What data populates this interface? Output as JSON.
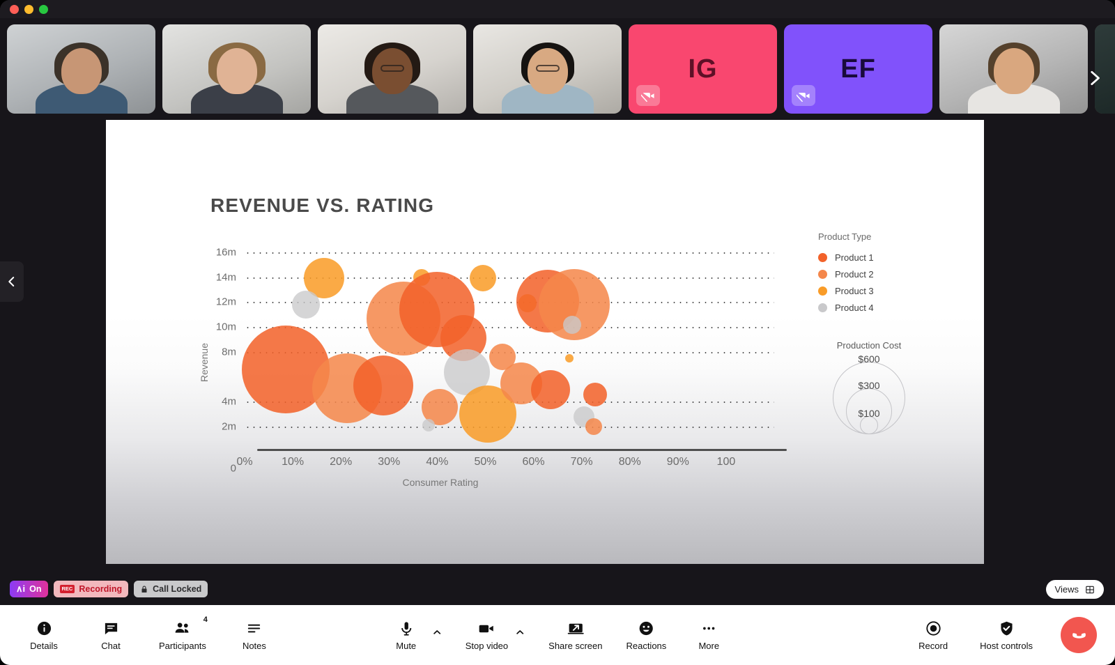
{
  "window": {
    "traffic_lights": [
      "close",
      "minimize",
      "zoom"
    ]
  },
  "filmstrip": {
    "next_icon": "chevron-right-icon",
    "participants": [
      {
        "type": "video",
        "name": "participant-1",
        "camera_off": false
      },
      {
        "type": "video",
        "name": "participant-2",
        "camera_off": false
      },
      {
        "type": "video",
        "name": "participant-3",
        "camera_off": false
      },
      {
        "type": "video",
        "name": "participant-4",
        "camera_off": false
      },
      {
        "type": "initials",
        "name": "participant-ig",
        "initials": "IG",
        "bg": "#f9476f",
        "fg": "#5e1027",
        "camera_off": true
      },
      {
        "type": "initials",
        "name": "participant-ef",
        "initials": "EF",
        "bg": "#8152fb",
        "fg": "#190a3c",
        "camera_off": true
      },
      {
        "type": "video",
        "name": "participant-7",
        "camera_off": false
      },
      {
        "type": "video",
        "name": "participant-8",
        "camera_off": false
      }
    ]
  },
  "stage": {
    "prev_icon": "chevron-left-icon"
  },
  "chart_data": {
    "type": "scatter",
    "title": "REVENUE VS. RATING",
    "xlabel": "Consumer Rating",
    "ylabel": "Revenue",
    "xlim": [
      0,
      110
    ],
    "ylim": [
      0,
      17
    ],
    "grid": true,
    "xticklabels": [
      "0%",
      "10%",
      "20%",
      "30%",
      "40%",
      "50%",
      "60%",
      "70%",
      "80%",
      "90%",
      "100"
    ],
    "xtickvalues": [
      0,
      10,
      20,
      30,
      40,
      50,
      60,
      70,
      80,
      90,
      100
    ],
    "yticklabels": [
      "16m",
      "14m",
      "12m",
      "10m",
      "8m",
      "4m",
      "2m",
      "0"
    ],
    "ytickvalues": [
      16,
      14,
      12,
      10,
      8,
      4,
      2,
      0
    ],
    "legend_title": "Product Type",
    "legend": [
      {
        "label": "Product 1",
        "color": "#f2622a"
      },
      {
        "label": "Product 2",
        "color": "#f4874b"
      },
      {
        "label": "Product 3",
        "color": "#f99c28"
      },
      {
        "label": "Product 4",
        "color": "#c9c9cb"
      }
    ],
    "size_legend_title": "Production Cost",
    "size_legend": [
      {
        "label": "$600",
        "radius": 52
      },
      {
        "label": "$300",
        "radius": 33
      },
      {
        "label": "$100",
        "radius": 13
      }
    ],
    "points": [
      {
        "x": 16.5,
        "y": 13.9,
        "r": 29,
        "series": "Product 3"
      },
      {
        "x": 12.8,
        "y": 11.8,
        "r": 20,
        "series": "Product 4"
      },
      {
        "x": 8.6,
        "y": 6.6,
        "r": 63,
        "series": "Product 1"
      },
      {
        "x": 21.3,
        "y": 5.1,
        "r": 50,
        "series": "Product 2"
      },
      {
        "x": 28.8,
        "y": 5.3,
        "r": 43,
        "series": "Product 1"
      },
      {
        "x": 33.0,
        "y": 10.7,
        "r": 53,
        "series": "Product 2"
      },
      {
        "x": 36.7,
        "y": 14.0,
        "r": 12,
        "series": "Product 3"
      },
      {
        "x": 40.0,
        "y": 11.4,
        "r": 54,
        "series": "Product 1"
      },
      {
        "x": 40.5,
        "y": 3.6,
        "r": 26,
        "series": "Product 2"
      },
      {
        "x": 38.2,
        "y": 2.1,
        "r": 9,
        "series": "Product 4"
      },
      {
        "x": 45.5,
        "y": 9.1,
        "r": 33,
        "series": "Product 1"
      },
      {
        "x": 46.2,
        "y": 6.4,
        "r": 33,
        "series": "Product 4"
      },
      {
        "x": 49.5,
        "y": 13.9,
        "r": 19,
        "series": "Product 3"
      },
      {
        "x": 50.5,
        "y": 3.0,
        "r": 41,
        "series": "Product 3"
      },
      {
        "x": 53.5,
        "y": 7.6,
        "r": 19,
        "series": "Product 2"
      },
      {
        "x": 57.5,
        "y": 5.5,
        "r": 30,
        "series": "Product 2"
      },
      {
        "x": 58.8,
        "y": 11.9,
        "r": 13,
        "series": "Product 3"
      },
      {
        "x": 63.0,
        "y": 12.1,
        "r": 45,
        "series": "Product 1"
      },
      {
        "x": 63.5,
        "y": 5.0,
        "r": 28,
        "series": "Product 1"
      },
      {
        "x": 67.5,
        "y": 7.5,
        "r": 6,
        "series": "Product 3"
      },
      {
        "x": 68.5,
        "y": 11.8,
        "r": 51,
        "series": "Product 2"
      },
      {
        "x": 68.0,
        "y": 10.2,
        "r": 13,
        "series": "Product 4"
      },
      {
        "x": 70.5,
        "y": 2.8,
        "r": 15,
        "series": "Product 4"
      },
      {
        "x": 72.8,
        "y": 4.6,
        "r": 17,
        "series": "Product 1"
      },
      {
        "x": 72.5,
        "y": 2.0,
        "r": 12,
        "series": "Product 2"
      }
    ]
  },
  "status_pills": {
    "ai": {
      "mark": "∧i",
      "label": "On"
    },
    "recording": {
      "badge": "REC",
      "label": "Recording"
    },
    "lock": {
      "icon": "lock-icon",
      "label": "Call Locked"
    }
  },
  "views_button": {
    "label": "Views",
    "icon": "grid-icon"
  },
  "controls": {
    "left": [
      {
        "name": "details",
        "label": "Details",
        "icon": "info-icon"
      },
      {
        "name": "chat",
        "label": "Chat",
        "icon": "chat-icon"
      },
      {
        "name": "participants",
        "label": "Participants",
        "icon": "people-icon",
        "badge": "4"
      },
      {
        "name": "notes",
        "label": "Notes",
        "icon": "notes-icon"
      }
    ],
    "center": [
      {
        "name": "mute",
        "label": "Mute",
        "icon": "microphone-icon",
        "has_caret": true
      },
      {
        "name": "stop-video",
        "label": "Stop video",
        "icon": "video-camera-icon",
        "has_caret": true
      },
      {
        "name": "share-screen",
        "label": "Share screen",
        "icon": "screen-share-icon",
        "has_caret": false
      },
      {
        "name": "reactions",
        "label": "Reactions",
        "icon": "smiley-icon",
        "has_caret": false
      },
      {
        "name": "more",
        "label": "More",
        "icon": "ellipsis-icon",
        "has_caret": false
      }
    ],
    "right": [
      {
        "name": "record",
        "label": "Record",
        "icon": "record-icon"
      },
      {
        "name": "host-controls",
        "label": "Host controls",
        "icon": "shield-check-icon"
      }
    ],
    "leave": {
      "name": "leave-call",
      "icon": "end-call-icon"
    }
  }
}
